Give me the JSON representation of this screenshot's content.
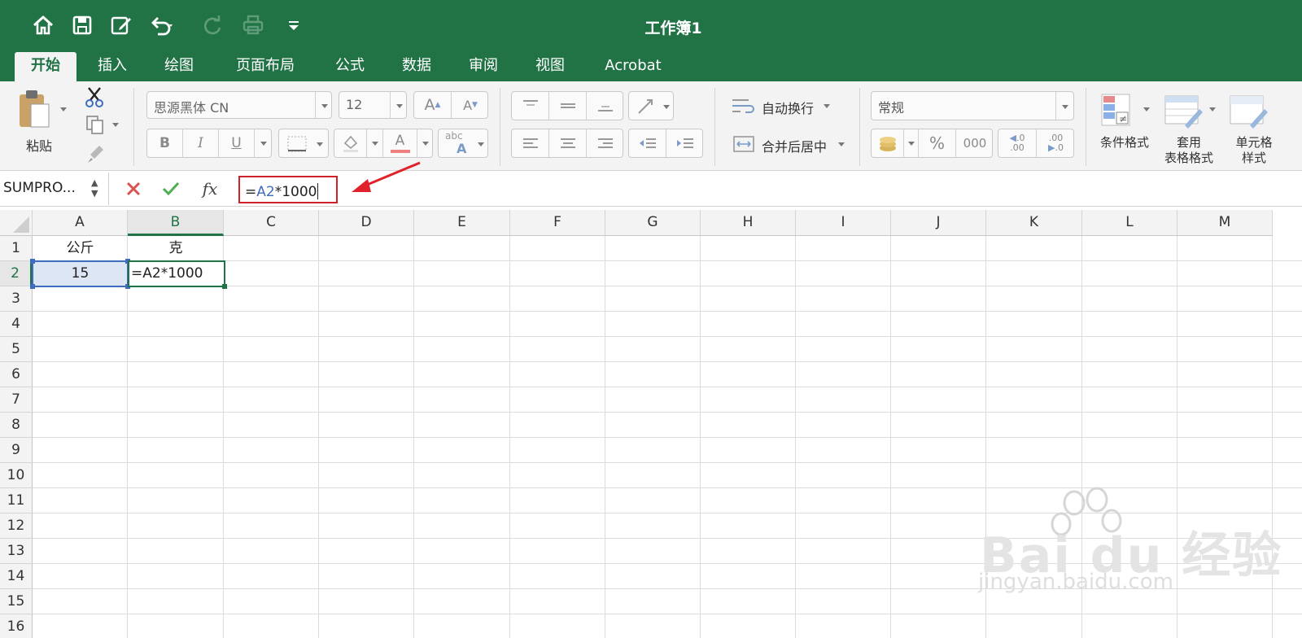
{
  "title_bar": {
    "document_title": "工作簿1",
    "quick_access": [
      "home-icon",
      "save-icon",
      "edit-icon",
      "undo-icon",
      "redo-icon",
      "print-icon",
      "customize-icon"
    ]
  },
  "ribbon_tabs": [
    {
      "label": "开始",
      "active": true
    },
    {
      "label": "插入"
    },
    {
      "label": "绘图"
    },
    {
      "label": "页面布局"
    },
    {
      "label": "公式"
    },
    {
      "label": "数据"
    },
    {
      "label": "审阅"
    },
    {
      "label": "视图"
    },
    {
      "label": "Acrobat"
    }
  ],
  "ribbon": {
    "paste_label": "粘贴",
    "font_name": "思源黑体 CN",
    "font_size": "12",
    "bold": "B",
    "italic": "I",
    "underline": "U",
    "font_color_letter": "A",
    "phonetic_top": "abc",
    "phonetic_bottom": "A",
    "grow_font": "A",
    "shrink_font": "A",
    "wrap_text_label": "自动换行",
    "merge_center_label": "合并后居中",
    "number_format": "常规",
    "percent": "%",
    "comma": "000",
    "increase_decimal_top": ".0",
    "increase_decimal_bottom": ".00",
    "decrease_decimal_top": ".00",
    "decrease_decimal_bottom": ".0",
    "conditional_format_label": "条件格式",
    "table_format_label_1": "套用",
    "table_format_label_2": "表格格式",
    "cell_style_label_1": "单元格",
    "cell_style_label_2": "样式"
  },
  "formula_bar": {
    "name_box": "SUMPRO...",
    "fx": "fx",
    "formula_prefix": "=",
    "formula_ref": "A2",
    "formula_suffix": "*1000"
  },
  "sheet": {
    "columns": [
      "A",
      "B",
      "C",
      "D",
      "E",
      "F",
      "G",
      "H",
      "I",
      "J",
      "K",
      "L",
      "M"
    ],
    "rows": [
      "1",
      "2",
      "3",
      "4",
      "5",
      "6",
      "7",
      "8",
      "9",
      "10",
      "11",
      "12",
      "13",
      "14",
      "15",
      "16"
    ],
    "selected_column": "B",
    "selected_row": "2",
    "cells": {
      "A1": "公斤",
      "B1": "克",
      "A2": "15",
      "B2": "=A2*1000"
    }
  },
  "watermark": {
    "logo_text": "Bai du 经验",
    "url": "jingyan.baidu.com"
  },
  "colors": {
    "excel_green": "#217346",
    "ref_blue": "#3e6cbf",
    "annotation_red": "#d0202a"
  }
}
